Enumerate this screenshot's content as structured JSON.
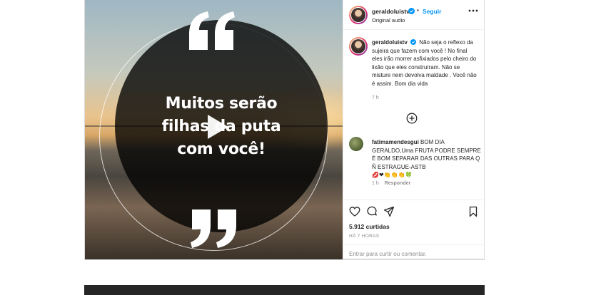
{
  "post": {
    "media": {
      "quote_open": "“",
      "quote_close": "”",
      "text_lines": [
        "Muitos serão",
        "filhas da puta",
        "com você!"
      ]
    },
    "header": {
      "username": "geraldoluistv",
      "separator": "•",
      "follow_label": "Seguir",
      "audio": "Original audio"
    },
    "caption": {
      "username": "geraldoluistv",
      "text": "Não seja o reflexo da sujeira que fazem com você ! No final eles irão morrer asfixiados pelo cheiro do lixão que eles construíram. Não se misture nem devolva maldade . Você não é assim. Bom dia vida",
      "time": "7 h"
    },
    "comment": {
      "username": "fatimamendesgui",
      "text": "BOM DIA GERALDO,Uma FRUTA PODRE SEMPRE É BOM SEPARAR DAS OUTRAS PARA Q Ñ ESTRAGUE-ASTB",
      "emojis": "💋❤👏👏👏🍀",
      "time": "1 h",
      "reply_label": "Responder"
    },
    "likes": "5.912 curtidas",
    "time_ago": "HÁ 7 HORAS",
    "add_comment_prompt": "Entrar para curtir ou comentar."
  },
  "icons": {
    "verified": "verified-badge-icon",
    "more": "more-options-icon",
    "load_more": "plus-circle-icon",
    "like": "heart-icon",
    "comment": "comment-icon",
    "share": "paper-plane-icon",
    "save": "bookmark-icon",
    "play": "play-icon"
  },
  "colors": {
    "accent": "#0095f6",
    "text": "#262626",
    "muted": "#8e8e8e",
    "border": "#dbdbdb"
  }
}
